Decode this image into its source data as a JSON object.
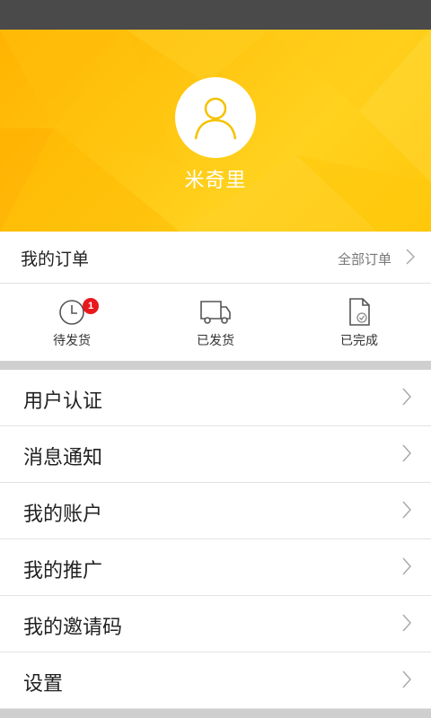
{
  "profile": {
    "username": "米奇里",
    "avatar_icon": "user-avatar-icon"
  },
  "orders": {
    "title": "我的订单",
    "all_link": "全部订单",
    "statuses": [
      {
        "label": "待发货",
        "icon": "clock-icon",
        "badge": "1"
      },
      {
        "label": "已发货",
        "icon": "truck-icon"
      },
      {
        "label": "已完成",
        "icon": "document-check-icon"
      }
    ]
  },
  "menu": {
    "items": [
      {
        "label": "用户认证"
      },
      {
        "label": "消息通知"
      },
      {
        "label": "我的账户"
      },
      {
        "label": "我的推广"
      },
      {
        "label": "我的邀请码"
      },
      {
        "label": "设置"
      }
    ]
  },
  "colors": {
    "status_bar": "#4a4a4a",
    "header_yellow": "#ffc40f",
    "badge_red": "#e8191e",
    "divider_gray": "#cfcfcf"
  }
}
